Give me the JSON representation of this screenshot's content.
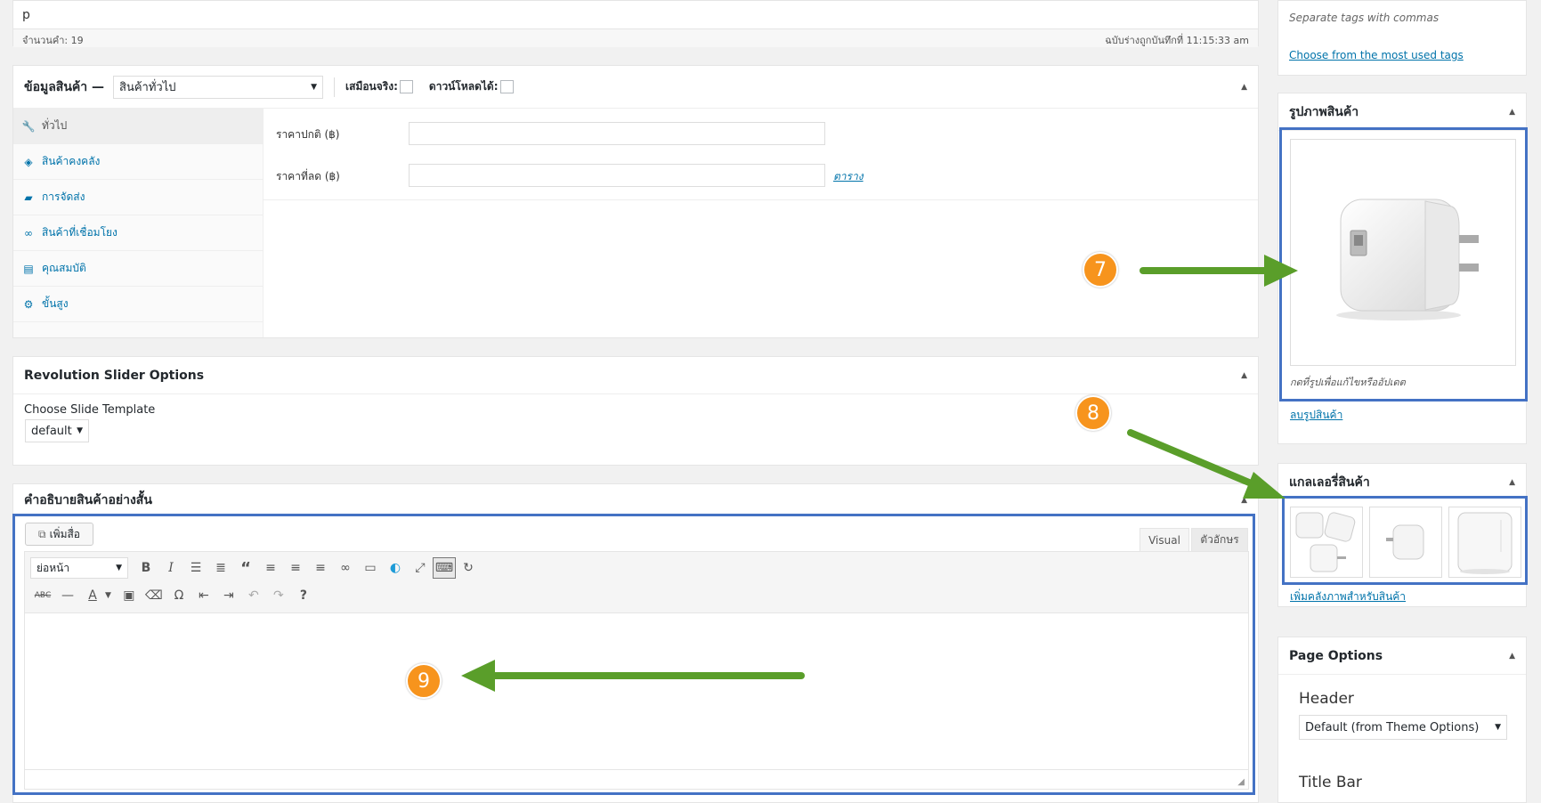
{
  "top_editor": {
    "content_text": "p",
    "word_count": "จำนวนคำ: 19",
    "draft_saved": "ฉบับร่างถูกบันทึกที่ 11:15:33 am"
  },
  "product_data": {
    "title": "ข้อมูลสินค้า —",
    "type_select": "สินค้าทั่วไป",
    "virtual_label": "เสมือนจริง:",
    "downloadable_label": "ดาวน์โหลดได้:",
    "tabs": [
      {
        "label": "ทั่วไป",
        "icon": "wrench-icon"
      },
      {
        "label": "สินค้าคงคลัง",
        "icon": "tag-icon"
      },
      {
        "label": "การจัดส่ง",
        "icon": "truck-icon"
      },
      {
        "label": "สินค้าที่เชื่อมโยง",
        "icon": "link-icon"
      },
      {
        "label": "คุณสมบัติ",
        "icon": "list-icon"
      },
      {
        "label": "ขั้นสูง",
        "icon": "gear-icon"
      }
    ],
    "regular_price_label": "ราคาปกติ (฿)",
    "sale_price_label": "ราคาที่ลด (฿)",
    "schedule_link": "ตาราง"
  },
  "revolution_slider": {
    "title": "Revolution Slider Options",
    "template_label": "Choose Slide Template",
    "template_value": "default"
  },
  "short_description": {
    "title": "คำอธิบายสินค้าอย่างสั้น",
    "add_media": "เพิ่มสื่อ",
    "tab_visual": "Visual",
    "tab_text": "ตัวอักษร",
    "format_select": "ย่อหน้า"
  },
  "tags": {
    "hint": "Separate tags with commas",
    "choose_link": "Choose from the most used tags"
  },
  "product_image": {
    "title": "รูปภาพสินค้า",
    "caption": "กดที่รูปเพื่อแก้ไขหรืออัปเดต",
    "remove_link": "ลบรูปสินค้า"
  },
  "gallery": {
    "title": "แกลเลอรี่สินค้า",
    "add_link": "เพิ่มคลังภาพสำหรับสินค้า"
  },
  "page_options": {
    "title": "Page Options",
    "header_label": "Header",
    "header_value": "Default (from Theme Options)",
    "title_bar_label": "Title Bar"
  },
  "callouts": [
    "7",
    "8",
    "9"
  ],
  "colors": {
    "link": "#0073aa",
    "callout_orange": "#f7941d",
    "arrow_green": "#5a9e2a",
    "highlight_blue": "#4472c4"
  }
}
